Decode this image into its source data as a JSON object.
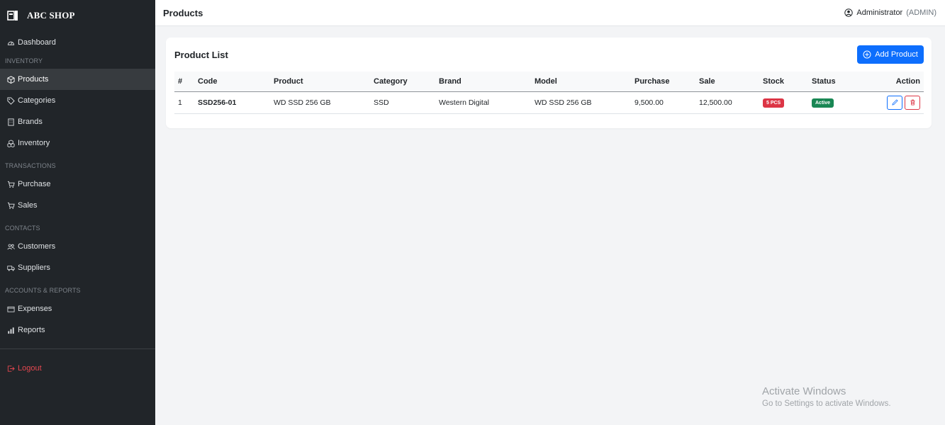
{
  "app": {
    "brand": "ABC SHOP"
  },
  "sidebar": {
    "dashboard": "Dashboard",
    "sections": {
      "inventory": "INVENTORY",
      "transactions": "TRANSACTIONS",
      "contacts": "CONTACTS",
      "accounts": "ACCOUNTS & REPORTS"
    },
    "items": {
      "products": "Products",
      "categories": "Categories",
      "brands": "Brands",
      "inventory": "Inventory",
      "purchase": "Purchase",
      "sales": "Sales",
      "customers": "Customers",
      "suppliers": "Suppliers",
      "expenses": "Expenses",
      "reports": "Reports"
    },
    "logout": "Logout",
    "active_item": "Products"
  },
  "header": {
    "title": "Products",
    "user_name": "Administrator",
    "user_role": "(ADMIN)"
  },
  "card": {
    "title": "Product List",
    "add_button": "Add Product"
  },
  "table": {
    "columns": [
      "#",
      "Code",
      "Product",
      "Category",
      "Brand",
      "Model",
      "Purchase",
      "Sale",
      "Stock",
      "Status",
      "Action"
    ],
    "rows": [
      {
        "no": "1",
        "code": "SSD256-01",
        "product": "WD SSD 256 GB",
        "category": "SSD",
        "brand": "Western Digital",
        "model": "WD SSD 256 GB",
        "purchase": "9,500.00",
        "sale": "12,500.00",
        "stock": "5 PCS",
        "status": "Active"
      }
    ]
  },
  "watermark": {
    "title": "Activate Windows",
    "subtitle": "Go to Settings to activate Windows."
  },
  "colors": {
    "sidebar_bg": "#212529",
    "primary": "#0d6efd",
    "danger": "#dc3545",
    "success": "#198754"
  }
}
